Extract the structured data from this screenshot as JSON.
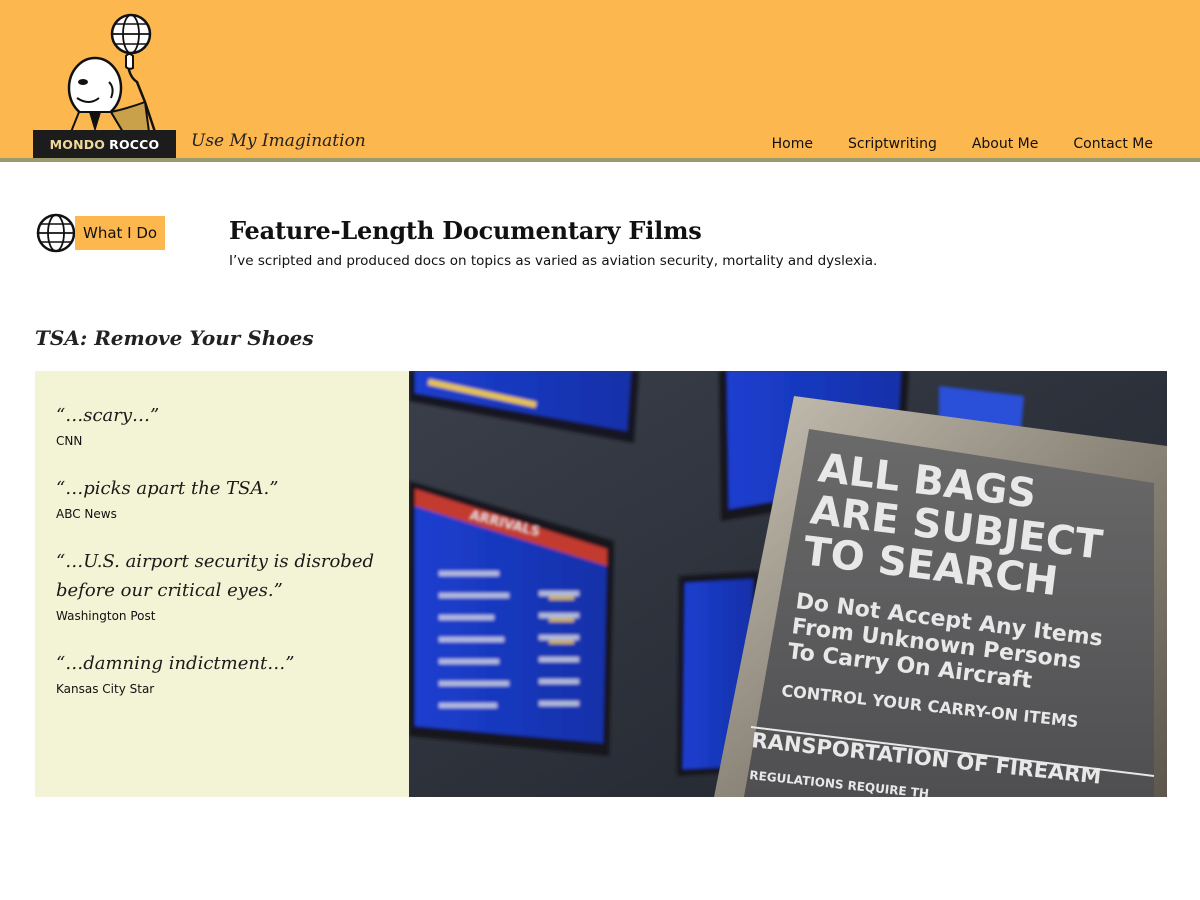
{
  "header": {
    "logo": {
      "word1": "MONDO",
      "word2": "ROCCO"
    },
    "tagline": "Use My Imagination",
    "nav": [
      {
        "label": "Home"
      },
      {
        "label": "Scriptwriting"
      },
      {
        "label": "About Me"
      },
      {
        "label": "Contact Me"
      }
    ]
  },
  "section": {
    "badge": "What I Do",
    "title": "Feature-Length Documentary Films",
    "subtitle": "I’ve scripted and produced docs on topics as varied as aviation security, mortality and dyslexia."
  },
  "film": {
    "title": "TSA: Remove Your Shoes",
    "quotes": [
      {
        "text": "“…scary…”",
        "source": "CNN"
      },
      {
        "text": "“…picks apart the TSA.”",
        "source": "ABC News"
      },
      {
        "text": "“…U.S. airport security is disrobed before our critical eyes.”",
        "source": "Washington Post"
      },
      {
        "text": "“…damning indictment…”",
        "source": "Kansas City Star"
      }
    ],
    "photo": {
      "sign_lines": [
        "ALL BAGS",
        "ARE SUBJECT",
        "TO SEARCH"
      ],
      "sign_small": [
        "Do Not Accept Any Items",
        "From Unknown Persons",
        "To Carry On Aircraft"
      ],
      "sign_control": "CONTROL YOUR CARRY-ON ITEMS",
      "sign_transport": "RANSPORTATION OF FIREARM",
      "sign_regs": "REGULATIONS REQUIRE TH",
      "board_header": "ARRIVALS"
    }
  },
  "colors": {
    "header_bg": "#fdb74f",
    "quotes_bg": "#f3f3d5"
  }
}
